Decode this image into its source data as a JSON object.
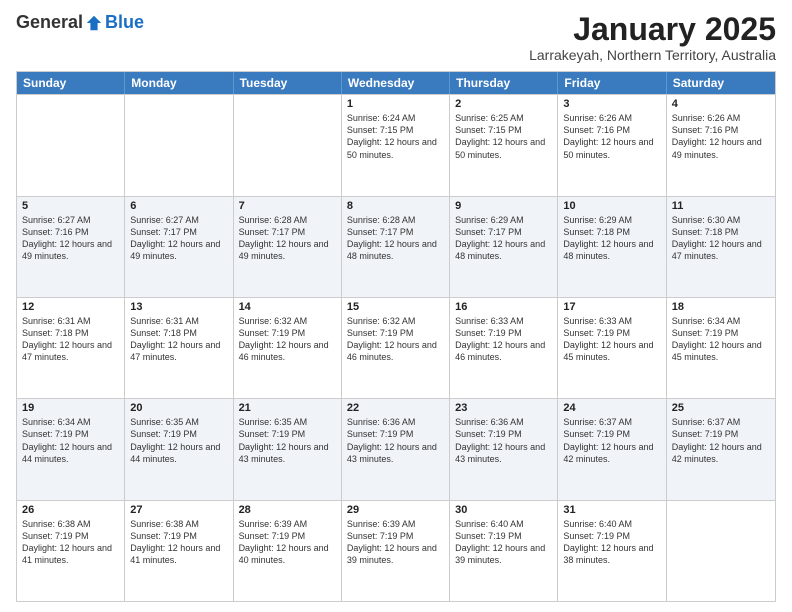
{
  "logo": {
    "general": "General",
    "blue": "Blue"
  },
  "title": "January 2025",
  "subtitle": "Larrakeyah, Northern Territory, Australia",
  "days_of_week": [
    "Sunday",
    "Monday",
    "Tuesday",
    "Wednesday",
    "Thursday",
    "Friday",
    "Saturday"
  ],
  "weeks": [
    {
      "alt": false,
      "cells": [
        {
          "day": "",
          "sunrise": "",
          "sunset": "",
          "daylight": ""
        },
        {
          "day": "",
          "sunrise": "",
          "sunset": "",
          "daylight": ""
        },
        {
          "day": "",
          "sunrise": "",
          "sunset": "",
          "daylight": ""
        },
        {
          "day": "1",
          "sunrise": "Sunrise: 6:24 AM",
          "sunset": "Sunset: 7:15 PM",
          "daylight": "Daylight: 12 hours and 50 minutes."
        },
        {
          "day": "2",
          "sunrise": "Sunrise: 6:25 AM",
          "sunset": "Sunset: 7:15 PM",
          "daylight": "Daylight: 12 hours and 50 minutes."
        },
        {
          "day": "3",
          "sunrise": "Sunrise: 6:26 AM",
          "sunset": "Sunset: 7:16 PM",
          "daylight": "Daylight: 12 hours and 50 minutes."
        },
        {
          "day": "4",
          "sunrise": "Sunrise: 6:26 AM",
          "sunset": "Sunset: 7:16 PM",
          "daylight": "Daylight: 12 hours and 49 minutes."
        }
      ]
    },
    {
      "alt": true,
      "cells": [
        {
          "day": "5",
          "sunrise": "Sunrise: 6:27 AM",
          "sunset": "Sunset: 7:16 PM",
          "daylight": "Daylight: 12 hours and 49 minutes."
        },
        {
          "day": "6",
          "sunrise": "Sunrise: 6:27 AM",
          "sunset": "Sunset: 7:17 PM",
          "daylight": "Daylight: 12 hours and 49 minutes."
        },
        {
          "day": "7",
          "sunrise": "Sunrise: 6:28 AM",
          "sunset": "Sunset: 7:17 PM",
          "daylight": "Daylight: 12 hours and 49 minutes."
        },
        {
          "day": "8",
          "sunrise": "Sunrise: 6:28 AM",
          "sunset": "Sunset: 7:17 PM",
          "daylight": "Daylight: 12 hours and 48 minutes."
        },
        {
          "day": "9",
          "sunrise": "Sunrise: 6:29 AM",
          "sunset": "Sunset: 7:17 PM",
          "daylight": "Daylight: 12 hours and 48 minutes."
        },
        {
          "day": "10",
          "sunrise": "Sunrise: 6:29 AM",
          "sunset": "Sunset: 7:18 PM",
          "daylight": "Daylight: 12 hours and 48 minutes."
        },
        {
          "day": "11",
          "sunrise": "Sunrise: 6:30 AM",
          "sunset": "Sunset: 7:18 PM",
          "daylight": "Daylight: 12 hours and 47 minutes."
        }
      ]
    },
    {
      "alt": false,
      "cells": [
        {
          "day": "12",
          "sunrise": "Sunrise: 6:31 AM",
          "sunset": "Sunset: 7:18 PM",
          "daylight": "Daylight: 12 hours and 47 minutes."
        },
        {
          "day": "13",
          "sunrise": "Sunrise: 6:31 AM",
          "sunset": "Sunset: 7:18 PM",
          "daylight": "Daylight: 12 hours and 47 minutes."
        },
        {
          "day": "14",
          "sunrise": "Sunrise: 6:32 AM",
          "sunset": "Sunset: 7:19 PM",
          "daylight": "Daylight: 12 hours and 46 minutes."
        },
        {
          "day": "15",
          "sunrise": "Sunrise: 6:32 AM",
          "sunset": "Sunset: 7:19 PM",
          "daylight": "Daylight: 12 hours and 46 minutes."
        },
        {
          "day": "16",
          "sunrise": "Sunrise: 6:33 AM",
          "sunset": "Sunset: 7:19 PM",
          "daylight": "Daylight: 12 hours and 46 minutes."
        },
        {
          "day": "17",
          "sunrise": "Sunrise: 6:33 AM",
          "sunset": "Sunset: 7:19 PM",
          "daylight": "Daylight: 12 hours and 45 minutes."
        },
        {
          "day": "18",
          "sunrise": "Sunrise: 6:34 AM",
          "sunset": "Sunset: 7:19 PM",
          "daylight": "Daylight: 12 hours and 45 minutes."
        }
      ]
    },
    {
      "alt": true,
      "cells": [
        {
          "day": "19",
          "sunrise": "Sunrise: 6:34 AM",
          "sunset": "Sunset: 7:19 PM",
          "daylight": "Daylight: 12 hours and 44 minutes."
        },
        {
          "day": "20",
          "sunrise": "Sunrise: 6:35 AM",
          "sunset": "Sunset: 7:19 PM",
          "daylight": "Daylight: 12 hours and 44 minutes."
        },
        {
          "day": "21",
          "sunrise": "Sunrise: 6:35 AM",
          "sunset": "Sunset: 7:19 PM",
          "daylight": "Daylight: 12 hours and 43 minutes."
        },
        {
          "day": "22",
          "sunrise": "Sunrise: 6:36 AM",
          "sunset": "Sunset: 7:19 PM",
          "daylight": "Daylight: 12 hours and 43 minutes."
        },
        {
          "day": "23",
          "sunrise": "Sunrise: 6:36 AM",
          "sunset": "Sunset: 7:19 PM",
          "daylight": "Daylight: 12 hours and 43 minutes."
        },
        {
          "day": "24",
          "sunrise": "Sunrise: 6:37 AM",
          "sunset": "Sunset: 7:19 PM",
          "daylight": "Daylight: 12 hours and 42 minutes."
        },
        {
          "day": "25",
          "sunrise": "Sunrise: 6:37 AM",
          "sunset": "Sunset: 7:19 PM",
          "daylight": "Daylight: 12 hours and 42 minutes."
        }
      ]
    },
    {
      "alt": false,
      "cells": [
        {
          "day": "26",
          "sunrise": "Sunrise: 6:38 AM",
          "sunset": "Sunset: 7:19 PM",
          "daylight": "Daylight: 12 hours and 41 minutes."
        },
        {
          "day": "27",
          "sunrise": "Sunrise: 6:38 AM",
          "sunset": "Sunset: 7:19 PM",
          "daylight": "Daylight: 12 hours and 41 minutes."
        },
        {
          "day": "28",
          "sunrise": "Sunrise: 6:39 AM",
          "sunset": "Sunset: 7:19 PM",
          "daylight": "Daylight: 12 hours and 40 minutes."
        },
        {
          "day": "29",
          "sunrise": "Sunrise: 6:39 AM",
          "sunset": "Sunset: 7:19 PM",
          "daylight": "Daylight: 12 hours and 39 minutes."
        },
        {
          "day": "30",
          "sunrise": "Sunrise: 6:40 AM",
          "sunset": "Sunset: 7:19 PM",
          "daylight": "Daylight: 12 hours and 39 minutes."
        },
        {
          "day": "31",
          "sunrise": "Sunrise: 6:40 AM",
          "sunset": "Sunset: 7:19 PM",
          "daylight": "Daylight: 12 hours and 38 minutes."
        },
        {
          "day": "",
          "sunrise": "",
          "sunset": "",
          "daylight": ""
        }
      ]
    }
  ]
}
